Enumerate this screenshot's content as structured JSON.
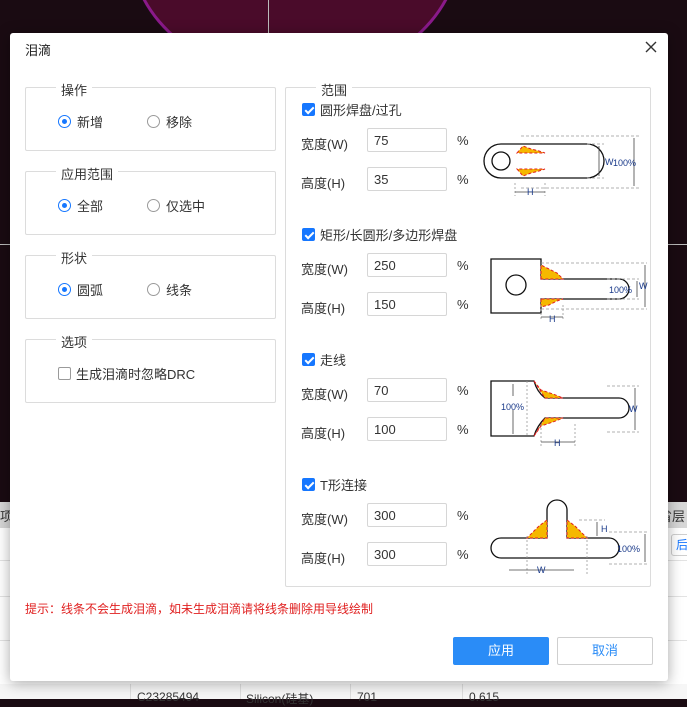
{
  "background": {
    "left_tab": "项",
    "right_tab": "省层",
    "side_button": "后",
    "bottom_row": [
      "C23285494",
      "Silicon(硅基)",
      "701",
      "0.615"
    ]
  },
  "dialog": {
    "title": "泪滴",
    "operation": {
      "legend": "操作",
      "options": [
        "新增",
        "移除"
      ],
      "selected": "新增"
    },
    "scope": {
      "legend": "应用范围",
      "options": [
        "全部",
        "仅选中"
      ],
      "selected": "全部"
    },
    "shape": {
      "legend": "形状",
      "options": [
        "圆弧",
        "线条"
      ],
      "selected": "圆弧"
    },
    "options": {
      "legend": "选项",
      "ignore_drc_label": "生成泪滴时忽略DRC",
      "ignore_drc_checked": false
    },
    "range": {
      "legend": "范围",
      "sections": [
        {
          "label": "圆形焊盘/过孔",
          "checked": true,
          "width_label": "宽度(W)",
          "width": "75",
          "height_label": "高度(H)",
          "height": "35",
          "unit": "%"
        },
        {
          "label": "矩形/长圆形/多边形焊盘",
          "checked": true,
          "width_label": "宽度(W)",
          "width": "250",
          "height_label": "高度(H)",
          "height": "150",
          "unit": "%"
        },
        {
          "label": "走线",
          "checked": true,
          "width_label": "宽度(W)",
          "width": "70",
          "height_label": "高度(H)",
          "height": "100",
          "unit": "%"
        },
        {
          "label": "T形连接",
          "checked": true,
          "width_label": "宽度(W)",
          "width": "300",
          "height_label": "高度(H)",
          "height": "300",
          "unit": "%"
        }
      ],
      "diagram_labels": {
        "w": "W",
        "h": "H",
        "pct": "100%"
      }
    },
    "hint": "提示：线条不会生成泪滴，如未生成泪滴请将线条删除用导线绘制",
    "apply_label": "应用",
    "cancel_label": "取消"
  },
  "colors": {
    "accent": "#1677ff",
    "hint": "#e02020",
    "teardrop_fill": "#f5b800",
    "teardrop_outline": "#e02020"
  }
}
